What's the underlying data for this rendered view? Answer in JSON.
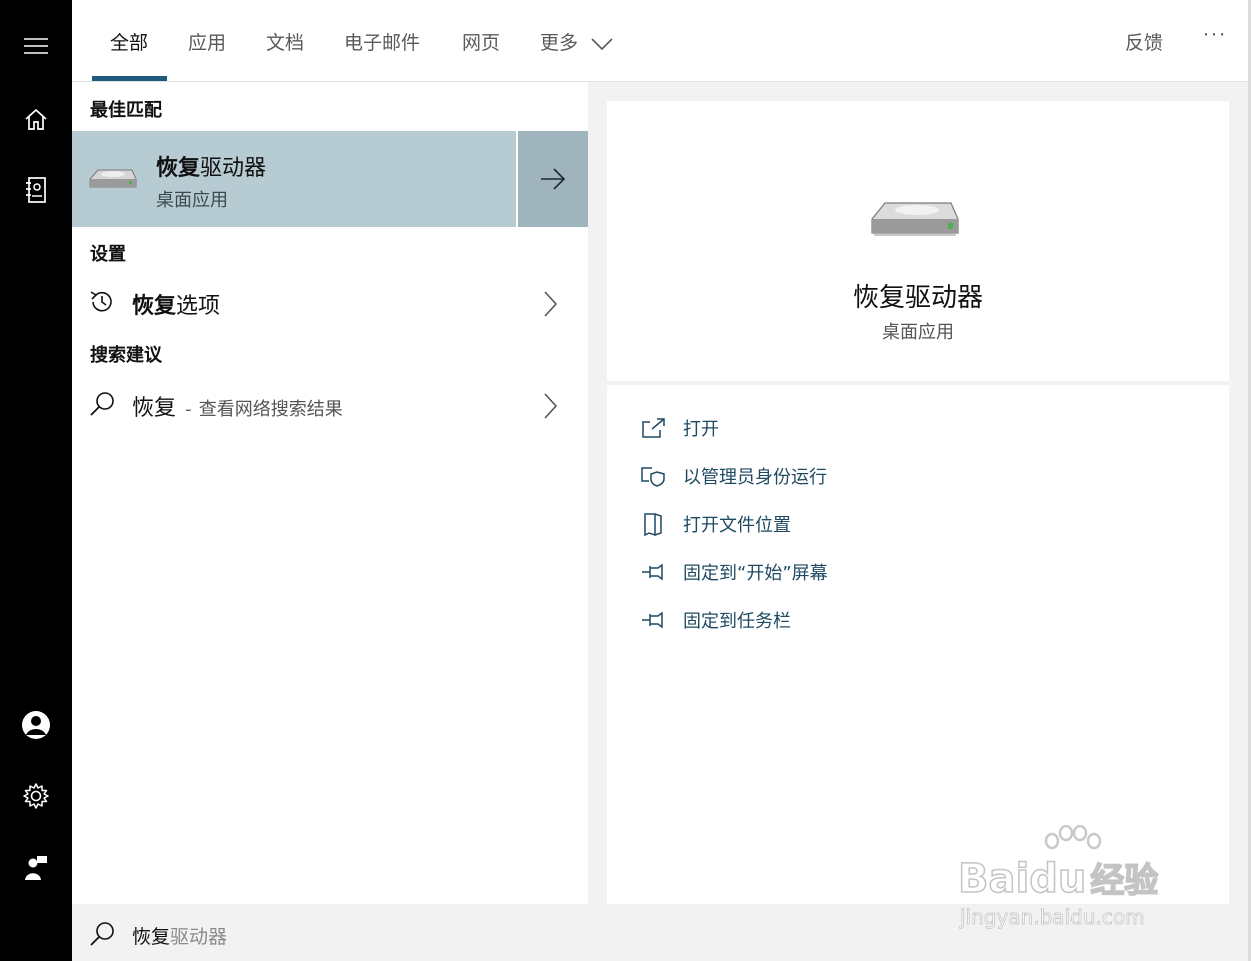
{
  "tabs": [
    {
      "label": "全部",
      "active": true
    },
    {
      "label": "应用"
    },
    {
      "label": "文档"
    },
    {
      "label": "电子邮件"
    },
    {
      "label": "网页"
    },
    {
      "label": "更多"
    }
  ],
  "header_right": {
    "feedback": "反馈",
    "more": "···"
  },
  "rail_icons": [
    "hamburger-icon",
    "home-icon",
    "notebook-icon",
    "user-icon",
    "settings-icon",
    "feedback-person-icon"
  ],
  "sections": {
    "best_match": "最佳匹配",
    "settings": "设置",
    "search_suggestions": "搜索建议"
  },
  "best_match": {
    "name_bold": "恢复",
    "name_rest": "驱动器",
    "subtitle": "桌面应用"
  },
  "settings_item": {
    "name_bold": "恢复",
    "name_rest": "选项"
  },
  "suggestion": {
    "term": "恢复",
    "sep": "-",
    "hint": "查看网络搜索结果"
  },
  "detail": {
    "title": "恢复驱动器",
    "subtitle": "桌面应用",
    "actions": [
      {
        "label": "打开",
        "icon": "open-icon"
      },
      {
        "label": "以管理员身份运行",
        "icon": "shield-admin-icon"
      },
      {
        "label": "打开文件位置",
        "icon": "file-location-icon"
      },
      {
        "label": "固定到“开始”屏幕",
        "icon": "pin-icon"
      },
      {
        "label": "固定到任务栏",
        "icon": "pin-icon"
      }
    ]
  },
  "search_box": {
    "typed": "恢复",
    "completion": "驱动器"
  },
  "watermark": {
    "brand": "Baidu",
    "cn": "经验",
    "url": "jingyan.baidu.com"
  },
  "colors": {
    "rail": "#000000",
    "accent": "#1f5a7a",
    "highlight": "#b7cbd3",
    "action_text": "#1f4a63"
  }
}
